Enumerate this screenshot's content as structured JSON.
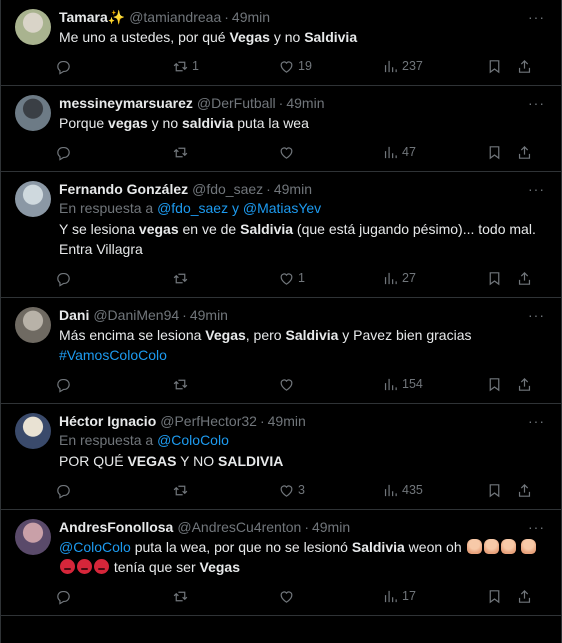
{
  "tweets": [
    {
      "name": "Tamara✨",
      "handle": "@tamiandreaa",
      "time": "49min",
      "reply_prefix": "",
      "reply_mention": "",
      "segments": [
        {
          "t": "Me uno a ustedes, por qué "
        },
        {
          "t": "Vegas",
          "b": true
        },
        {
          "t": " y no "
        },
        {
          "t": "Saldivia",
          "b": true
        }
      ],
      "replies": "",
      "retweets": "1",
      "likes": "19",
      "views": "237",
      "avatar_colors": [
        "#d9d4c8",
        "#a9b38f"
      ]
    },
    {
      "name": "messineymarsuarez",
      "handle": "@DerFutball",
      "time": "49min",
      "reply_prefix": "",
      "reply_mention": "",
      "segments": [
        {
          "t": "Porque "
        },
        {
          "t": "vegas",
          "b": true
        },
        {
          "t": " y no "
        },
        {
          "t": "saldivia",
          "b": true
        },
        {
          "t": " puta la wea"
        }
      ],
      "replies": "",
      "retweets": "",
      "likes": "",
      "views": "47",
      "avatar_colors": [
        "#3a3f45",
        "#6d7b86"
      ]
    },
    {
      "name": "Fernando González",
      "handle": "@fdo_saez",
      "time": "49min",
      "reply_prefix": "En respuesta a ",
      "reply_mention": "@fdo_saez y @MatiasYev",
      "segments": [
        {
          "t": "Y se lesiona "
        },
        {
          "t": "vegas",
          "b": true
        },
        {
          "t": " en ve de "
        },
        {
          "t": "Saldivia",
          "b": true
        },
        {
          "t": " (que está jugando pésimo)... todo mal. Entra Villagra"
        }
      ],
      "replies": "",
      "retweets": "",
      "likes": "1",
      "views": "27",
      "avatar_colors": [
        "#cfd9de",
        "#8b98a5"
      ]
    },
    {
      "name": "Dani",
      "handle": "@DaniMen94",
      "time": "49min",
      "reply_prefix": "",
      "reply_mention": "",
      "segments": [
        {
          "t": "Más encima se lesiona "
        },
        {
          "t": "Vegas",
          "b": true
        },
        {
          "t": ", pero "
        },
        {
          "t": "Saldivia",
          "b": true
        },
        {
          "t": " y Pavez bien gracias "
        },
        {
          "t": "#VamosColoColo",
          "link": true
        }
      ],
      "replies": "",
      "retweets": "",
      "likes": "",
      "views": "154",
      "avatar_colors": [
        "#b8b2a8",
        "#6f6a62"
      ]
    },
    {
      "name": "Héctor Ignacio",
      "handle": "@PerfHector32",
      "time": "49min",
      "reply_prefix": "En respuesta a ",
      "reply_mention": "@ColoColo",
      "segments": [
        {
          "t": "POR QUÉ "
        },
        {
          "t": "VEGAS",
          "b": true
        },
        {
          "t": " Y NO "
        },
        {
          "t": "SALDIVIA",
          "b": true
        }
      ],
      "replies": "",
      "retweets": "",
      "likes": "3",
      "views": "435",
      "avatar_colors": [
        "#e9e2d3",
        "#3a4a6b"
      ]
    },
    {
      "name": "AndresFonollosa",
      "handle": "@AndresCu4renton",
      "time": "49min",
      "reply_prefix": "",
      "reply_mention": "",
      "segments": [
        {
          "t": "@ColoColo",
          "link": true
        },
        {
          "t": " puta la wea, por que no se lesionó "
        },
        {
          "t": "Saldivia",
          "b": true
        },
        {
          "t": " weon oh "
        },
        {
          "emoji": "pray"
        },
        {
          "emoji": "pray"
        },
        {
          "emoji": "pray"
        },
        {
          "t": " "
        },
        {
          "emoji": "pray"
        },
        {
          "emoji": "angry"
        },
        {
          "emoji": "angry"
        },
        {
          "emoji": "angry"
        },
        {
          "t": " tenía que ser "
        },
        {
          "t": "Vegas",
          "b": true
        }
      ],
      "replies": "",
      "retweets": "",
      "likes": "",
      "views": "17",
      "avatar_colors": [
        "#c9a0a8",
        "#5a4a6a"
      ]
    }
  ],
  "icons": {
    "reply": "reply-icon",
    "retweet": "retweet-icon",
    "like": "like-icon",
    "views": "views-icon",
    "bookmark": "bookmark-icon",
    "share": "share-icon",
    "more": "more-icon"
  },
  "more_label": "···",
  "colors": {
    "background": "#000000",
    "text": "#e7e9ea",
    "secondary": "#71767b",
    "link": "#1d9bf0",
    "divider": "#2f3336"
  }
}
